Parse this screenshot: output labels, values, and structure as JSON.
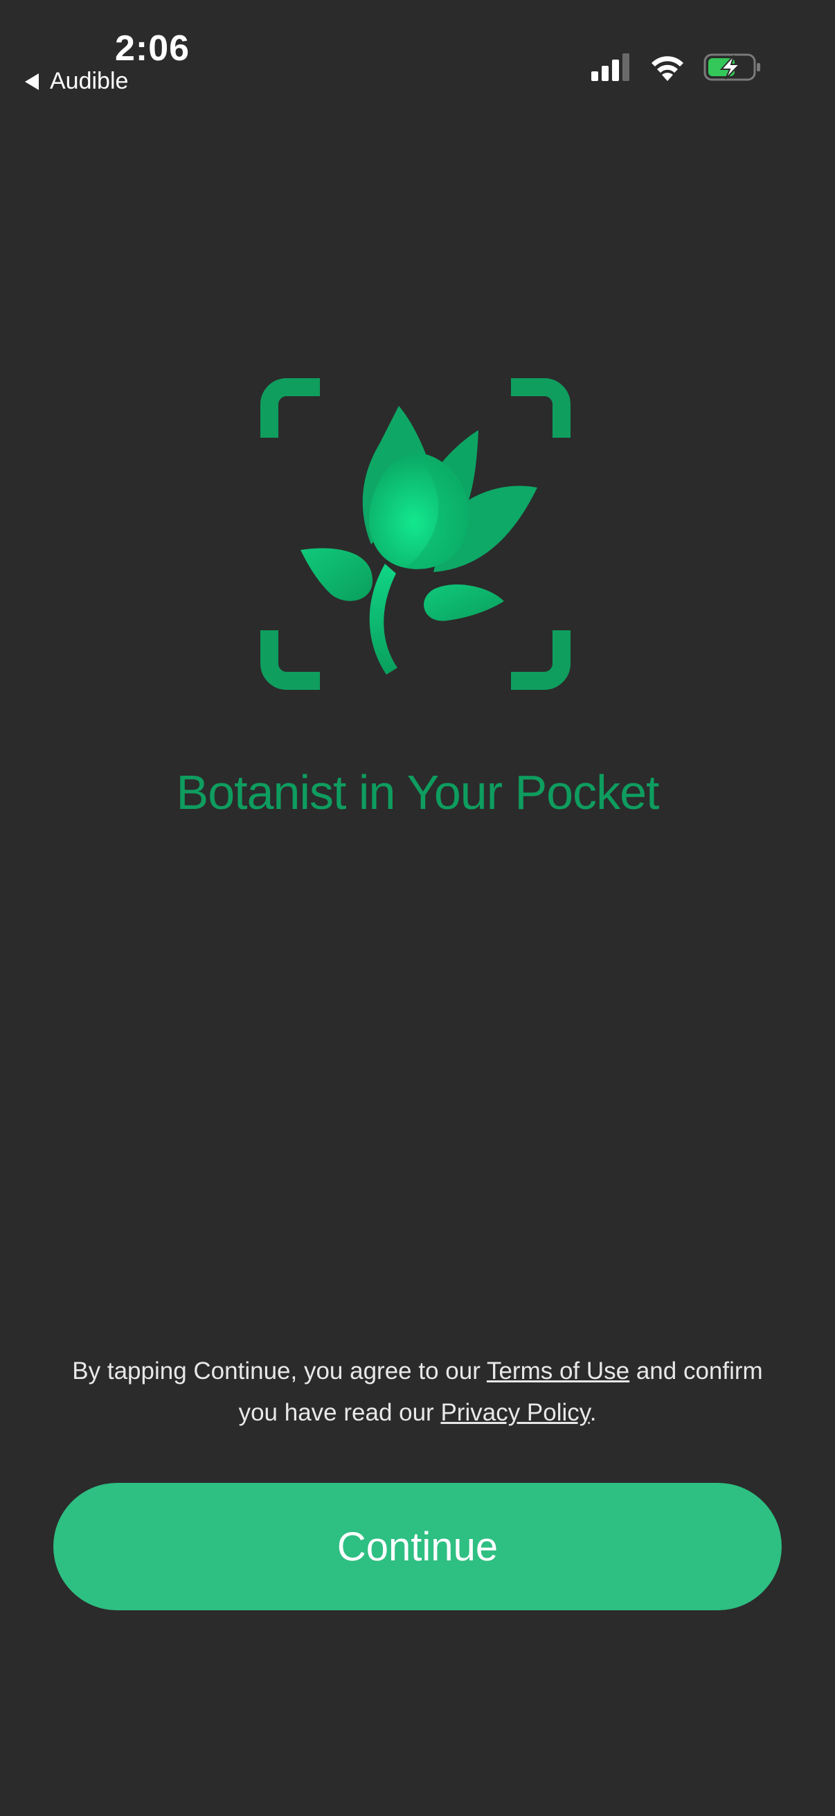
{
  "status_bar": {
    "time": "2:06",
    "back_app": "Audible",
    "icons": [
      "signal-icon",
      "wifi-icon",
      "battery-charging-icon"
    ]
  },
  "logo": {
    "icon": "plant-scan-icon",
    "brand_color": "#0e9d5f"
  },
  "tagline": "Botanist in Your Pocket",
  "legal": {
    "prefix": "By tapping Continue, you agree to our ",
    "terms_link": "Terms of Use",
    "middle": " and confirm you have read our ",
    "privacy_link": "Privacy Policy",
    "suffix": "."
  },
  "continue_button": {
    "label": "Continue",
    "color": "#2ebf82"
  }
}
